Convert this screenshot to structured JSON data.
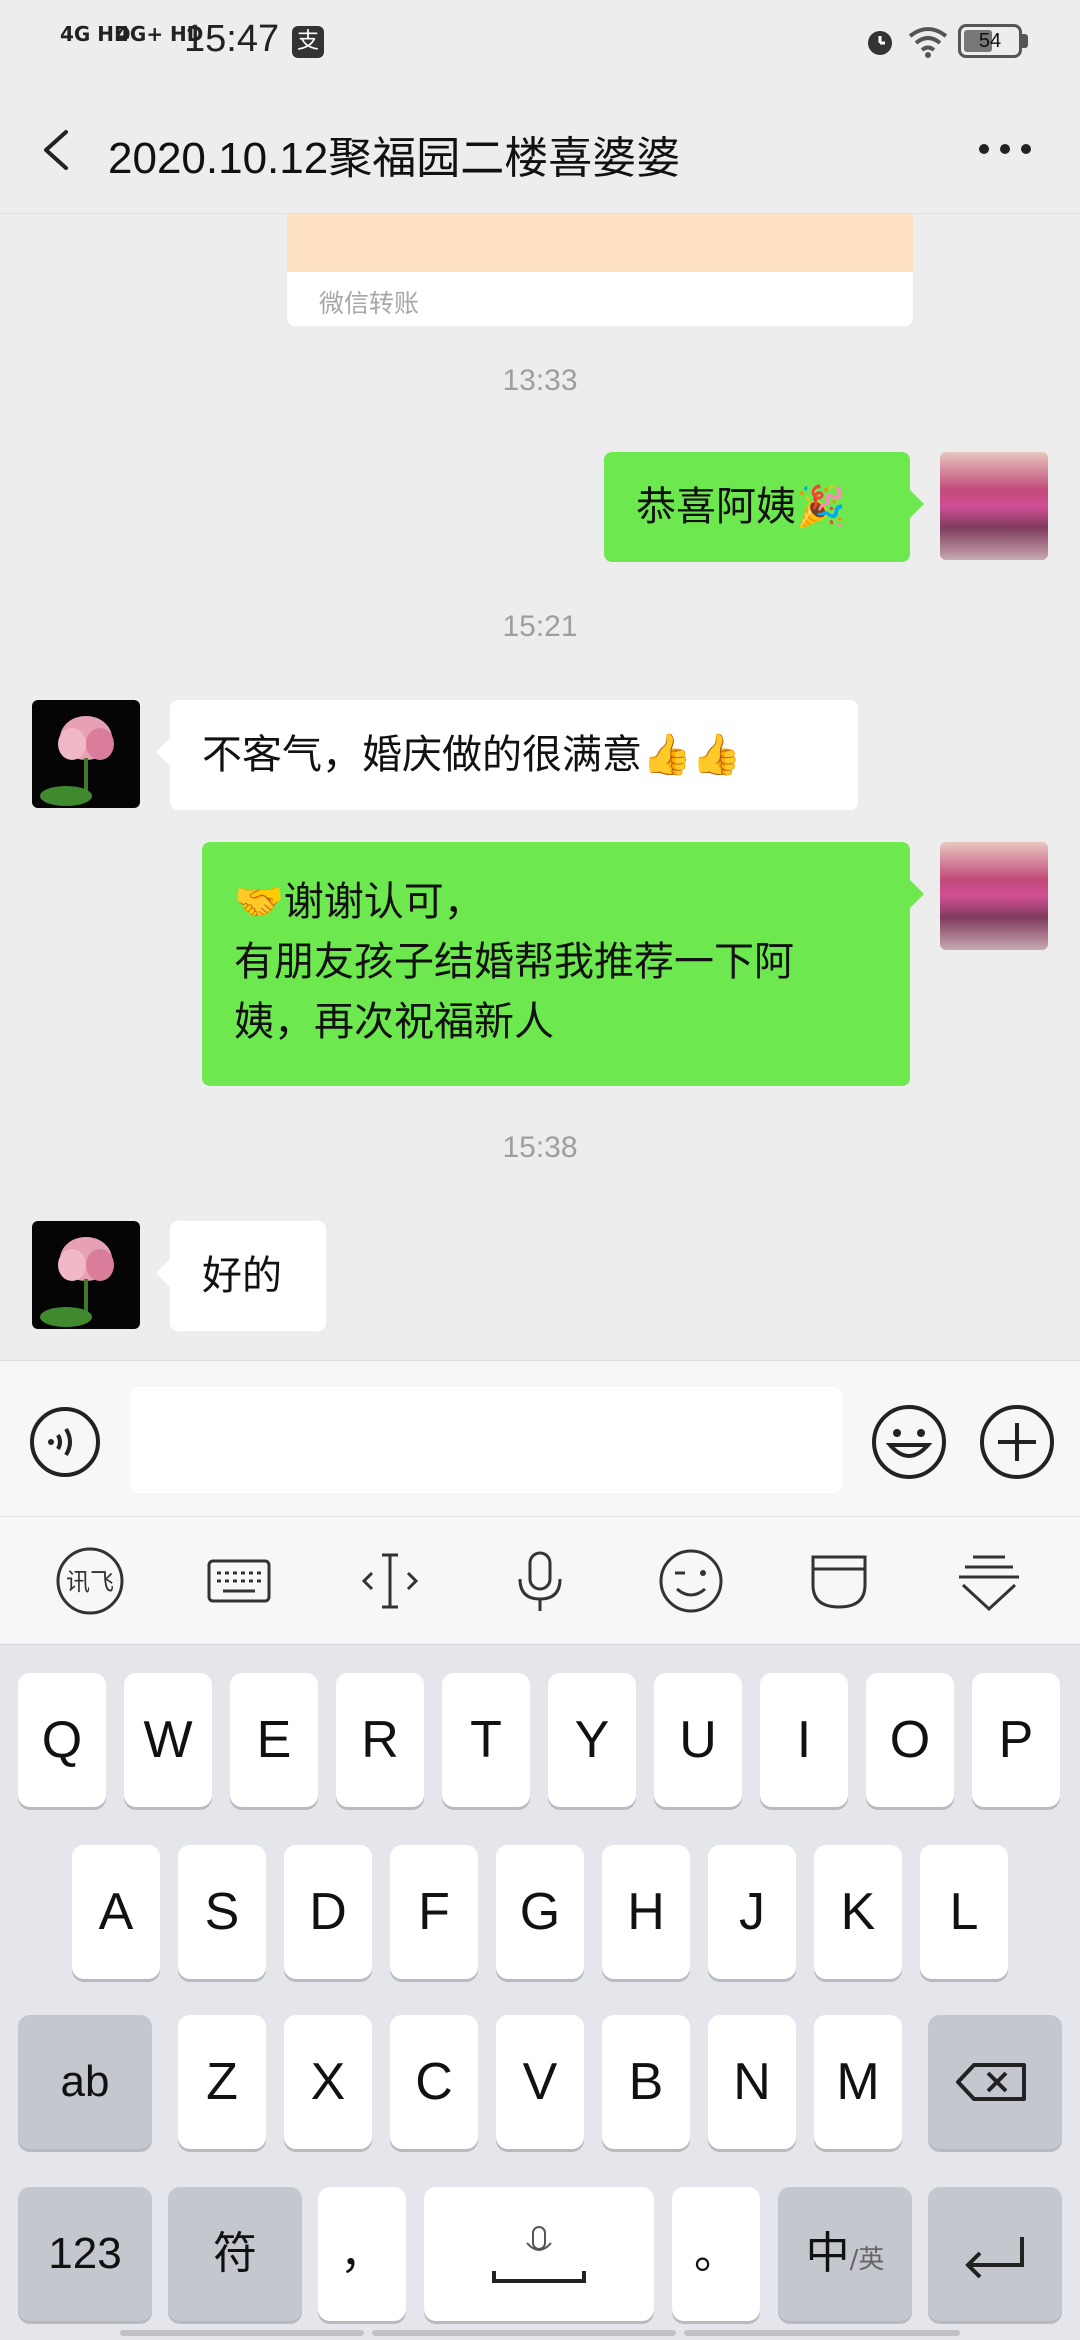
{
  "status_bar": {
    "signal_1": "4G HD",
    "signal_2": "4G+ HD",
    "time": "15:47",
    "pay_icon": "支",
    "battery": "54"
  },
  "nav": {
    "title": "2020.10.12聚福园二楼喜婆婆"
  },
  "chat": {
    "transfer_label": "微信转账",
    "messages": [
      {
        "type": "time",
        "text": "13:33"
      },
      {
        "type": "outgoing",
        "lines": [
          "恭喜阿姨🎉"
        ]
      },
      {
        "type": "time",
        "text": "15:21"
      },
      {
        "type": "incoming",
        "lines": [
          "不客气，婚庆做的很满意👍👍"
        ]
      },
      {
        "type": "outgoing",
        "lines": [
          "🤝谢谢认可，",
          "有朋友孩子结婚帮我推荐一下阿",
          "姨，再次祝福新人"
        ]
      },
      {
        "type": "time",
        "text": "15:38"
      },
      {
        "type": "incoming",
        "lines": [
          "好的"
        ]
      }
    ]
  },
  "keyboard": {
    "row1": [
      "Q",
      "W",
      "E",
      "R",
      "T",
      "Y",
      "U",
      "I",
      "O",
      "P"
    ],
    "row2": [
      "A",
      "S",
      "D",
      "F",
      "G",
      "H",
      "J",
      "K",
      "L"
    ],
    "row3": [
      "Z",
      "X",
      "C",
      "V",
      "B",
      "N",
      "M"
    ],
    "ab": "ab",
    "num": "123",
    "sym": "符",
    "comma": "，",
    "period": "。",
    "lang_main": "中",
    "lang_sub": "/英"
  },
  "colors": {
    "outgoing_bubble": "#6ee84f",
    "incoming_bubble": "#ffffff",
    "background": "#ededed"
  }
}
